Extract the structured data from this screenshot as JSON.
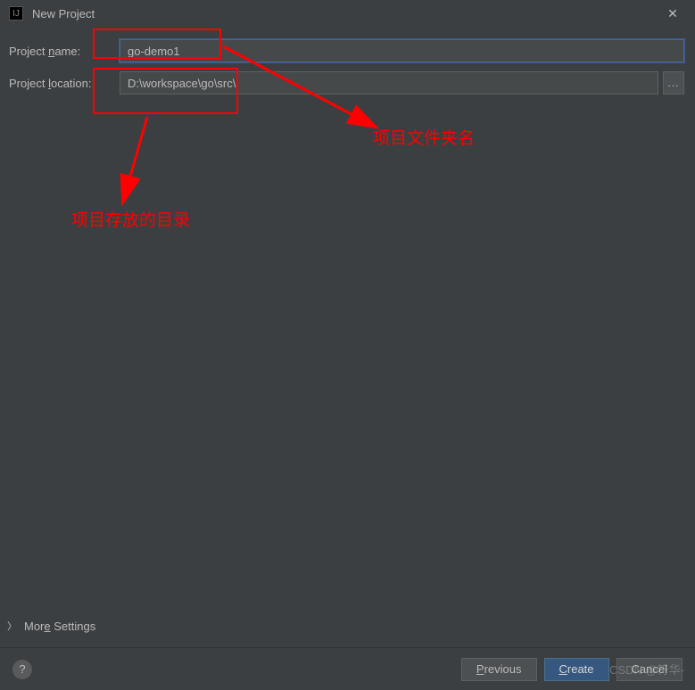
{
  "titlebar": {
    "title": "New Project"
  },
  "form": {
    "name_label_pre": "Project ",
    "name_label_u": "n",
    "name_label_post": "ame:",
    "name_value": "go-demo1",
    "location_label_pre": "Project ",
    "location_label_u": "l",
    "location_label_post": "ocation:",
    "location_value": "D:\\workspace\\go\\src\\",
    "browse": "..."
  },
  "annotations": {
    "folder_name": "项目文件夹名",
    "storage_dir": "项目存放的目录"
  },
  "more": {
    "label_pre": "Mor",
    "label_u": "e",
    "label_post": " Settings"
  },
  "buttons": {
    "previous_u": "P",
    "previous_post": "revious",
    "create_u": "C",
    "create_post": "reate",
    "cancel": "Cancel"
  },
  "watermark": "CSDN @符华-",
  "help": "?"
}
